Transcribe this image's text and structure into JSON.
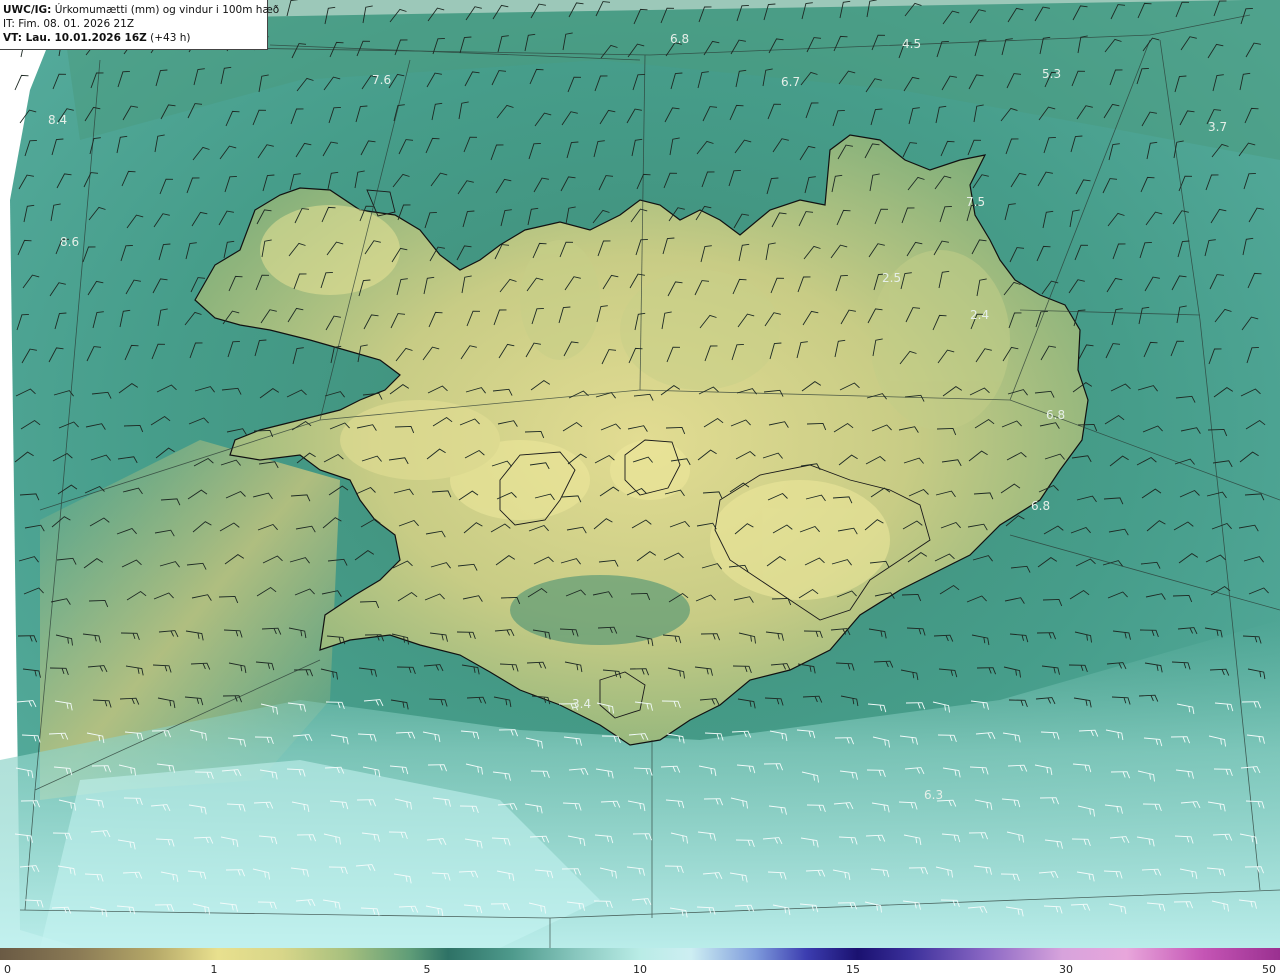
{
  "header": {
    "title_code": "UWC/IG:",
    "title_text": "Úrkomumætti (mm) og vindur i 100m hæð",
    "issue_time": "IT: Fim. 08. 01. 2026 21Z",
    "valid_time": "VT: Lau. 10.01.2026 16Z",
    "lead_time": "(+43 h)"
  },
  "colors": {
    "ocean_deep": "#3f8a7a",
    "ocean_light": "#a6e3df",
    "land_low": "#4f8f70",
    "land_high": "#e6e092",
    "coast": "#111111",
    "wind_barb": "#1e2a24",
    "graticule": "#2a3a34"
  },
  "value_labels": [
    {
      "text": "6.8"
    },
    {
      "text": "4.5"
    },
    {
      "text": "5.3"
    },
    {
      "text": "7.6"
    },
    {
      "text": "6.7"
    },
    {
      "text": "8.4"
    },
    {
      "text": "3.7"
    },
    {
      "text": "7.5"
    },
    {
      "text": "8.6"
    },
    {
      "text": "2.5"
    },
    {
      "text": "2.4"
    },
    {
      "text": "6.8"
    },
    {
      "text": "6.8"
    },
    {
      "text": "3.4"
    },
    {
      "text": "6.3"
    }
  ],
  "legend": {
    "ticks": [
      "0",
      "1",
      "5",
      "10",
      "15",
      "30",
      "50"
    ]
  }
}
